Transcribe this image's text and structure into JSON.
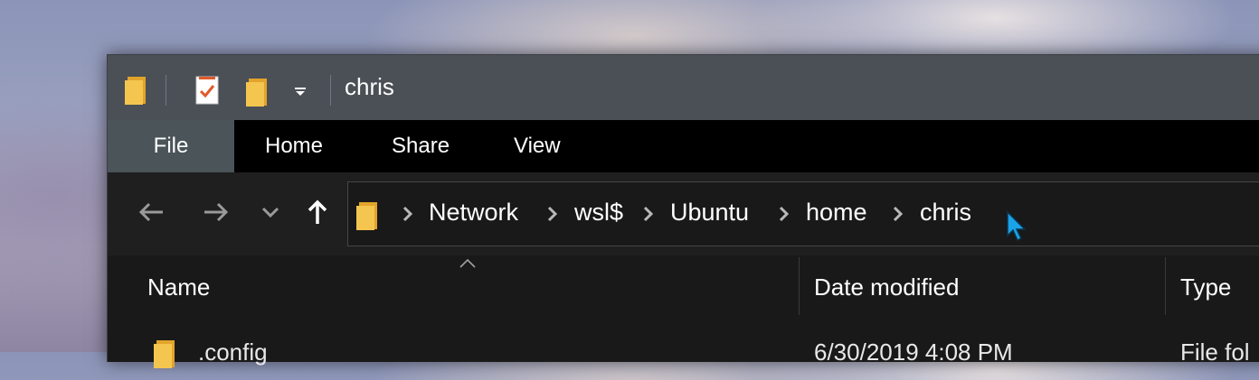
{
  "titlebar": {
    "title": "chris",
    "icons": [
      "folder-icon",
      "properties-icon",
      "new-folder-icon",
      "customize-dropdown-icon"
    ]
  },
  "ribbon": {
    "tabs": [
      {
        "label": "File",
        "active": true
      },
      {
        "label": "Home"
      },
      {
        "label": "Share"
      },
      {
        "label": "View"
      }
    ]
  },
  "nav": {
    "buttons": [
      "back-arrow-icon",
      "forward-arrow-icon",
      "recent-dropdown-icon",
      "up-arrow-icon"
    ],
    "breadcrumb": [
      "Network",
      "wsl$",
      "Ubuntu",
      "home",
      "chris"
    ]
  },
  "columns": {
    "name": "Name",
    "date_modified": "Date modified",
    "type": "Type"
  },
  "files": [
    {
      "name": ".config",
      "date": "6/30/2019 4:08 PM",
      "type": "File fol"
    }
  ],
  "colors": {
    "titlebar": "#4a5055",
    "ribbon": "#000000",
    "file_tab": "#4a5459",
    "folder": "#f5c64f",
    "cursor": "#1aa3e8"
  }
}
